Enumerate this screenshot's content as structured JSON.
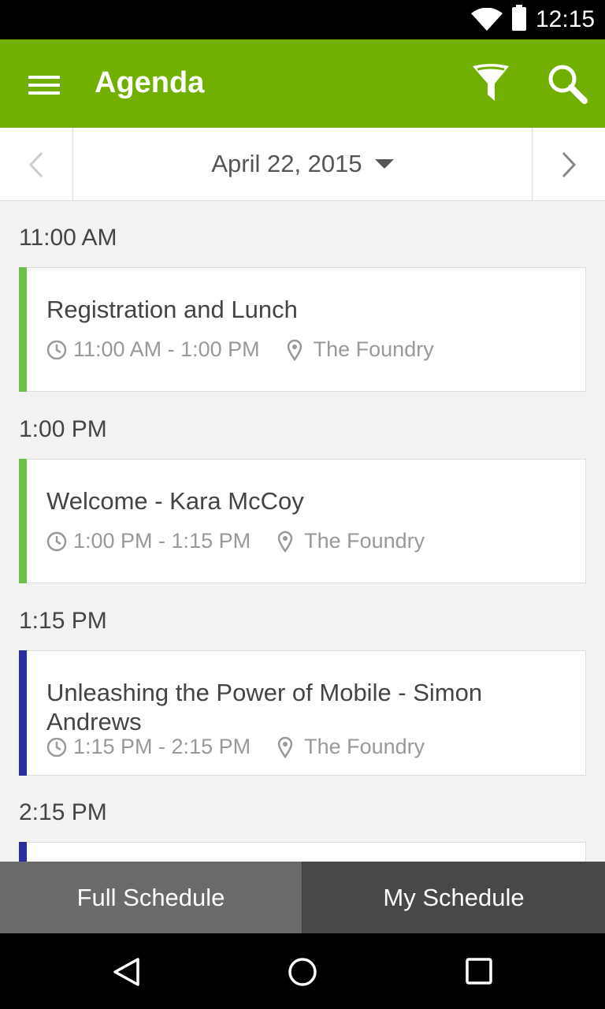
{
  "status_bar": {
    "time": "12:15"
  },
  "app_bar": {
    "title": "Agenda"
  },
  "date_bar": {
    "date": "April 22, 2015"
  },
  "colors": {
    "brand": "#71b000",
    "accent_green": "#6cc04a",
    "accent_blue": "#2a2fa0"
  },
  "agenda": [
    {
      "time": "11:00 AM",
      "title": "Registration and Lunch",
      "range": "11:00 AM - 1:00 PM",
      "location": "The Foundry",
      "accent": "#6cc04a"
    },
    {
      "time": "1:00 PM",
      "title": "Welcome - Kara McCoy",
      "range": "1:00 PM - 1:15 PM",
      "location": "The Foundry",
      "accent": "#6cc04a"
    },
    {
      "time": "1:15 PM",
      "title": "Unleashing the Power of Mobile - Simon Andrews",
      "range": "1:15 PM - 2:15 PM",
      "location": "The Foundry",
      "accent": "#2a2fa0"
    },
    {
      "time": "2:15 PM"
    }
  ],
  "tabs": {
    "full": "Full Schedule",
    "my": "My Schedule"
  }
}
